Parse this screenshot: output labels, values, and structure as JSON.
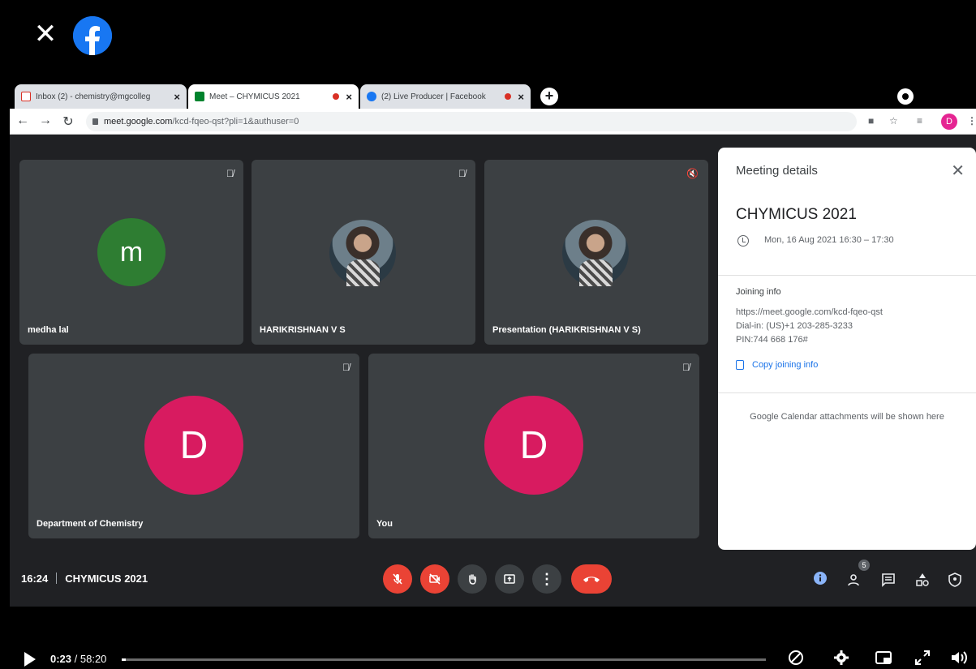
{
  "overlay": {
    "close_glyph": "✕",
    "fb_letter": "f"
  },
  "tabs": [
    {
      "label": "Inbox (2) - chemistry@mgcolleg",
      "close": "×",
      "favicon": "gmail-icon",
      "color": "#d93025"
    },
    {
      "label": "Meet – CHYMICUS 2021",
      "close": "×",
      "favicon": "meet-icon",
      "color": "#00832d"
    },
    {
      "label": "(2) Live Producer | Facebook",
      "close": "×",
      "favicon": "facebook-icon",
      "color": "#1877f2"
    }
  ],
  "browser": {
    "url_host": "meet.google.com",
    "url_path": "/kcd-fqeo-qst?pli=1&authuser=0",
    "avatar_letter": "D"
  },
  "tiles": [
    {
      "name": "medha lal",
      "avatar_letter": "m",
      "avatar_color": "#2e7d32"
    },
    {
      "name": "HARIKRISHNAN V S"
    },
    {
      "name": "Presentation (HARIKRISHNAN V S)"
    },
    {
      "name": "Department of Chemistry",
      "avatar_letter": "D",
      "avatar_color": "#d81b60"
    },
    {
      "name": "You",
      "avatar_letter": "D",
      "avatar_color": "#d81b60"
    }
  ],
  "panel": {
    "heading": "Meeting details",
    "close": "✕",
    "meeting_title": "CHYMICUS 2021",
    "when": "Mon, 16 Aug 2021 16:30 – 17:30",
    "joining_heading": "Joining info",
    "link": "https://meet.google.com/kcd-fqeo-qst",
    "dialin": "Dial-in: (US)+1 203-285-3233",
    "pin": "PIN:744 668 176#",
    "copy_label": "Copy joining info",
    "attachments_note": "Google Calendar attachments will be shown here"
  },
  "bottombar": {
    "time": "16:24",
    "meeting_name": "CHYMICUS 2021",
    "participants_count": "5"
  },
  "video": {
    "current": "0:23",
    "separator": " / ",
    "duration": "58:20",
    "progress": 0.0066
  }
}
